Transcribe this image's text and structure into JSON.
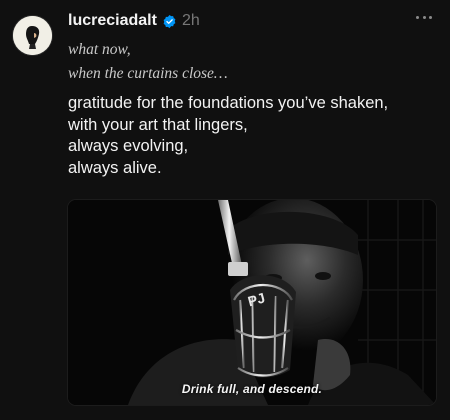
{
  "post": {
    "username": "lucreciadalt",
    "verified_icon": "verified-badge-icon",
    "time": "2h",
    "more_icon": "more-horizontal-icon",
    "italic_lines": [
      "what now,",
      "when the curtains close…"
    ],
    "body_lines": [
      "gratitude for the foundations you’ve shaken,",
      "with your art that lingers,",
      "always evolving,",
      "always alive."
    ],
    "media": {
      "subtitle": "Drink full, and descend.",
      "mic_badge": "PJ"
    },
    "colors": {
      "background": "#101010",
      "verified": "#0095f6",
      "muted": "#777777"
    }
  }
}
